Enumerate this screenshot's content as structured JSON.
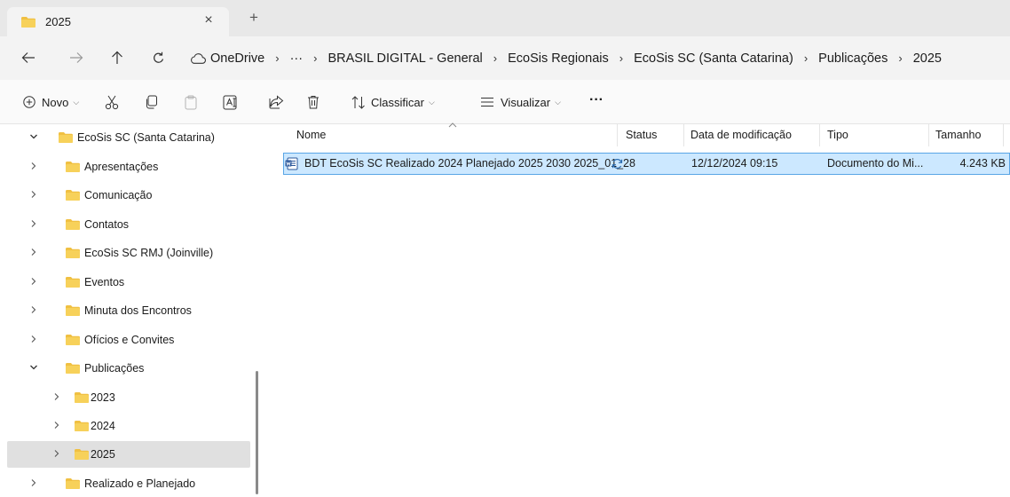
{
  "tab": {
    "title": "2025",
    "close": "×",
    "new_tab": "+"
  },
  "nav": {
    "back": "←",
    "forward": "→",
    "up": "↑",
    "refresh": "↻"
  },
  "address": {
    "crumbs": [
      "OneDrive",
      "···",
      "BRASIL DIGITAL - General",
      "EcoSis Regionais",
      "EcoSis SC (Santa Catarina)",
      "Publicações",
      "2025"
    ],
    "separator": "›"
  },
  "toolbar": {
    "new_label": "Novo",
    "sort_label": "Classificar",
    "view_label": "Visualizar",
    "more_label": "···"
  },
  "sidebar": {
    "items": [
      {
        "label": "EcoSis SC (Santa Catarina)",
        "expanded": true
      },
      {
        "label": "Apresentações"
      },
      {
        "label": "Comunicação"
      },
      {
        "label": "Contatos"
      },
      {
        "label": "EcoSis SC RMJ (Joinville)"
      },
      {
        "label": "Eventos"
      },
      {
        "label": "Minuta dos Encontros"
      },
      {
        "label": "Ofícios e Convites"
      },
      {
        "label": "Publicações",
        "expanded": true
      },
      {
        "label": "2023"
      },
      {
        "label": "2024"
      },
      {
        "label": "2025",
        "selected": true
      },
      {
        "label": "Realizado e Planejado"
      }
    ]
  },
  "columns": {
    "name": "Nome",
    "status": "Status",
    "modified": "Data de modificação",
    "type": "Tipo",
    "size": "Tamanho"
  },
  "files": [
    {
      "name": "BDT EcoSis SC Realizado 2024  Planejado 2025 2030 2025_01_28",
      "status_icon": "sync-icon",
      "modified": "12/12/2024 09:15",
      "type": "Documento do Mi...",
      "size": "4.243 KB"
    }
  ],
  "colors": {
    "selection": "#cce8ff",
    "selection_border": "#5aa6e6",
    "folder": "#f0c042",
    "word": "#2b579a"
  }
}
